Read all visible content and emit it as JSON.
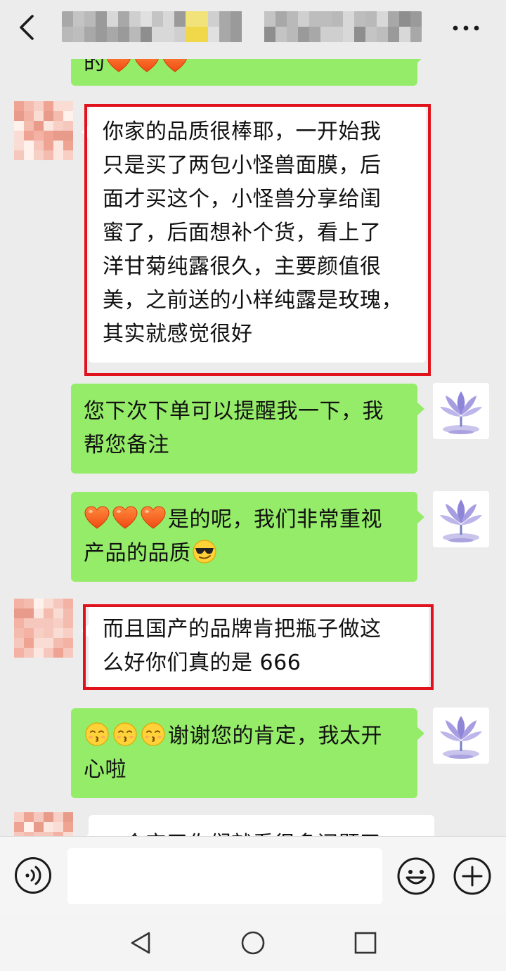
{
  "header": {
    "title": "",
    "back_icon": "chevron-left-icon",
    "more_icon": "more-dots-icon"
  },
  "messages": [
    {
      "sender": "me",
      "text_suffix": "的",
      "emojis": [
        "heart",
        "heart",
        "heart"
      ],
      "partial": "top"
    },
    {
      "sender": "them",
      "highlighted": true,
      "lines": [
        "你家的品质很棒耶，一开始我",
        "只是买了两包小怪兽面膜，后",
        "面才买这个，小怪兽分享给闺",
        "蜜了，后面想补个货，看上了",
        "洋甘菊纯露很久，主要颜值很",
        "美，之前送的小样纯露是玫瑰，",
        "其实就感觉很好"
      ]
    },
    {
      "sender": "me",
      "lines": [
        "您下次下单可以提醒我一下，我",
        "帮您备注"
      ]
    },
    {
      "sender": "me",
      "emojis": [
        "heart",
        "heart",
        "heart"
      ],
      "lines": [
        "是的呢，我们非常重视",
        "产品的品质"
      ],
      "trailing_emoji": "sunglasses"
    },
    {
      "sender": "them",
      "highlighted": true,
      "lines": [
        "而且国产的品牌肯把瓶子做这",
        "么好你们真的是 666"
      ]
    },
    {
      "sender": "me",
      "emojis": [
        "kissing",
        "kissing",
        "kissing"
      ],
      "lines": [
        "谢谢您的肯定，我太开",
        "心啦"
      ]
    },
    {
      "sender": "them",
      "partial": "bottom",
      "lines": [
        "一会完了你们就看很多问题了"
      ]
    }
  ],
  "input": {
    "placeholder": "",
    "value": "",
    "voice_icon": "voice-icon",
    "emoji_icon": "emoji-icon",
    "plus_icon": "plus-icon"
  },
  "system_nav": {
    "back_icon": "nav-back-icon",
    "home_icon": "nav-home-icon",
    "recent_icon": "nav-recent-icon"
  },
  "colors": {
    "my_bubble": "#95ec69",
    "their_bubble": "#ffffff",
    "highlight": "#e0121b",
    "background": "#ececec"
  }
}
